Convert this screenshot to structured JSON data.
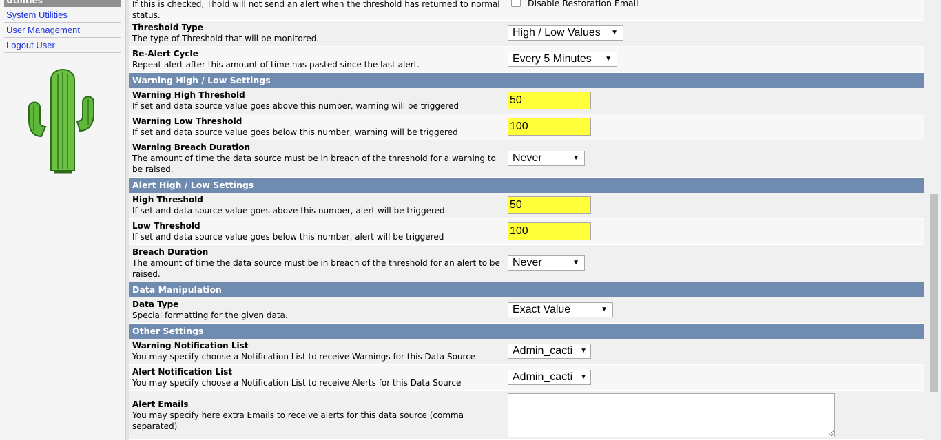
{
  "sidebar": {
    "header": "Utilities",
    "items": [
      {
        "label": "System Utilities"
      },
      {
        "label": "User Management"
      },
      {
        "label": "Logout User"
      }
    ]
  },
  "rows": {
    "restoration": {
      "desc": "If this is checked, Thold will not send an alert when the threshold has returned to normal status.",
      "checkbox_label": "Disable Restoration Email"
    },
    "threshold_type": {
      "title": "Threshold Type",
      "desc": "The type of Threshold that will be monitored.",
      "value": "High / Low Values"
    },
    "realert": {
      "title": "Re-Alert Cycle",
      "desc": "Repeat alert after this amount of time has pasted since the last alert.",
      "value": "Every 5 Minutes"
    },
    "warn_high": {
      "title": "Warning High Threshold",
      "desc": "If set and data source value goes above this number, warning will be triggered",
      "value": "50"
    },
    "warn_low": {
      "title": "Warning Low Threshold",
      "desc": "If set and data source value goes below this number, warning will be triggered",
      "value": "100"
    },
    "warn_breach": {
      "title": "Warning Breach Duration",
      "desc": "The amount of time the data source must be in breach of the threshold for a warning to be raised.",
      "value": "Never"
    },
    "high": {
      "title": "High Threshold",
      "desc": "If set and data source value goes above this number, alert will be triggered",
      "value": "50"
    },
    "low": {
      "title": "Low Threshold",
      "desc": "If set and data source value goes below this number, alert will be triggered",
      "value": "100"
    },
    "breach": {
      "title": "Breach Duration",
      "desc": "The amount of time the data source must be in breach of the threshold for an alert to be raised.",
      "value": "Never"
    },
    "data_type": {
      "title": "Data Type",
      "desc": "Special formatting for the given data.",
      "value": "Exact Value"
    },
    "warn_notify": {
      "title": "Warning Notification List",
      "desc": "You may specify choose a Notification List to receive Warnings for this Data Source",
      "value": "Admin_cacti"
    },
    "alert_notify": {
      "title": "Alert Notification List",
      "desc": "You may specify choose a Notification List to receive Alerts for this Data Source",
      "value": "Admin_cacti"
    },
    "alert_emails": {
      "title": "Alert Emails",
      "desc": "You may specify here extra Emails to receive alerts for this data source (comma separated)",
      "value": ""
    }
  },
  "sections": {
    "warning": "Warning High / Low Settings",
    "alert": "Alert High / Low Settings",
    "data": "Data Manipulation",
    "other": "Other Settings"
  },
  "icons": {
    "logo": "cactus-logo",
    "dropdown": "chevron-down-icon"
  },
  "colors": {
    "section_header": "#6f8bb0",
    "highlight": "#ffff3a",
    "link": "#1d32d9"
  }
}
